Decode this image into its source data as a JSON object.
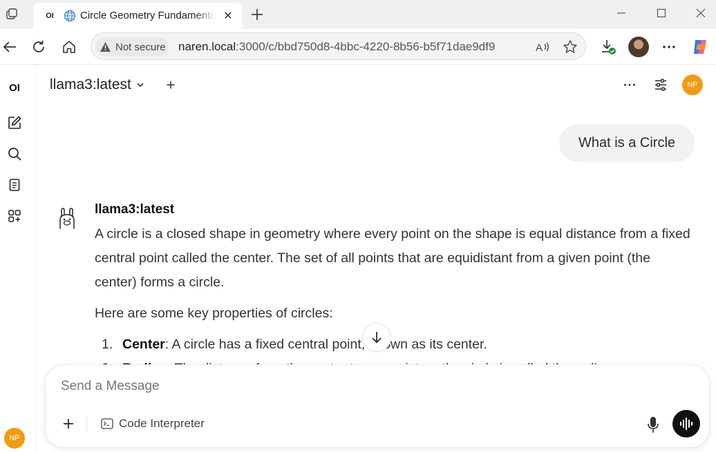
{
  "browser": {
    "tab": {
      "favicon_text": "OI",
      "title": "Circle Geometry Fundamentals",
      "close_glyph": "✕"
    },
    "address": {
      "security_label": "Not secure",
      "url_host": "naren.local",
      "url_rest": ":3000/c/bbd750d8-4bbc-4220-8b56-b5f71dae9df9"
    }
  },
  "sidebar": {
    "logo": "OI",
    "user_initials": "NP"
  },
  "header": {
    "model_name": "llama3:latest",
    "user_initials": "NP"
  },
  "chat": {
    "user_message": "What is a Circle",
    "assistant": {
      "name": "llama3:latest",
      "paragraph1": "A circle is a closed shape in geometry where every point on the shape is equal distance from a fixed central point called the center. The set of all points that are equidistant from a given point (the center) forms a circle.",
      "paragraph2": "Here are some key properties of circles:",
      "list": [
        {
          "num": "1.",
          "term": "Center",
          "text": ": A circle has a fixed central point, known as its center."
        },
        {
          "num": "2.",
          "term": "Radius",
          "text": ": The distance from the center to any point on the circle is called the radius."
        }
      ]
    }
  },
  "composer": {
    "placeholder": "Send a Message",
    "code_interpreter_label": "Code Interpreter"
  },
  "colors": {
    "accent_avatar": "#f29a12",
    "bubble": "#f2f2f2"
  }
}
